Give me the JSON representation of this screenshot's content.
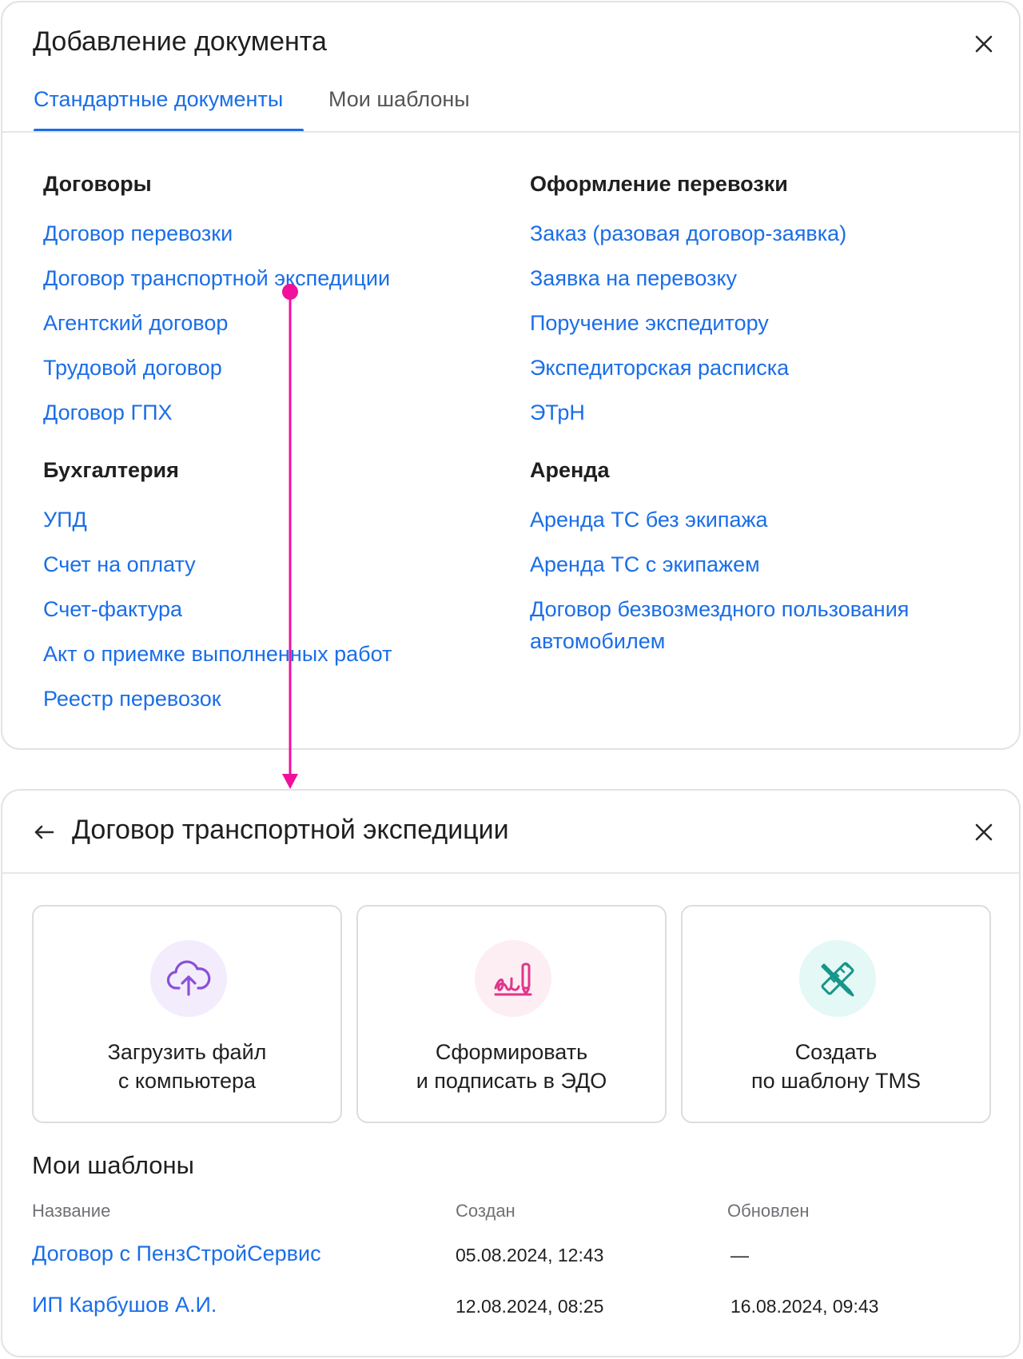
{
  "top_dialog": {
    "title": "Добавление документа",
    "tabs": [
      {
        "label": "Стандартные документы",
        "active": true
      },
      {
        "label": "Мои шаблоны",
        "active": false
      }
    ],
    "left_column": [
      {
        "heading": "Договоры",
        "items": [
          "Договор перевозки",
          "Договор транспортной экспедиции",
          "Агентский договор",
          "Трудовой договор",
          "Договор ГПХ"
        ]
      },
      {
        "heading": "Бухгалтерия",
        "items": [
          "УПД",
          "Счет на оплату",
          "Счет-фактура",
          "Акт о приемке выполненных работ",
          "Реестр перевозок"
        ]
      }
    ],
    "right_column": [
      {
        "heading": "Оформление перевозки",
        "items": [
          "Заказ (разовая договор-заявка)",
          "Заявка на перевозку",
          "Поручение экспедитору",
          "Экспедиторская расписка",
          "ЭТрН"
        ]
      },
      {
        "heading": "Аренда",
        "items": [
          "Аренда ТС без экипажа",
          "Аренда ТС с экипажем",
          "Договор безвозмездного пользования автомобилем"
        ]
      }
    ]
  },
  "bottom_dialog": {
    "title": "Договор транспортной экспедиции",
    "cards": [
      {
        "line1": "Загрузить файл",
        "line2": "с компьютера",
        "icon": "cloud-upload-icon",
        "icon_color": "#8a4fd8",
        "circle_color": "#f3ecfd"
      },
      {
        "line1": "Сформировать",
        "line2": "и подписать в ЭДО",
        "icon": "signature-icon",
        "icon_color": "#e0358a",
        "circle_color": "#fdeef4"
      },
      {
        "line1": "Создать",
        "line2": "по шаблону TMS",
        "icon": "pencil-ruler-icon",
        "icon_color": "#16958a",
        "circle_color": "#e4f8f5"
      }
    ],
    "templates": {
      "title": "Мои шаблоны",
      "columns": [
        "Название",
        "Создан",
        "Обновлен"
      ],
      "rows": [
        {
          "name": "Договор с ПензСтройСервис",
          "created": "05.08.2024, 12:43",
          "updated": "—"
        },
        {
          "name": "ИП Карбушов А.И.",
          "created": "12.08.2024, 08:25",
          "updated": "16.08.2024, 09:43"
        }
      ]
    }
  },
  "colors": {
    "accent": "#1a6ee8",
    "connector": "#f0109c"
  }
}
